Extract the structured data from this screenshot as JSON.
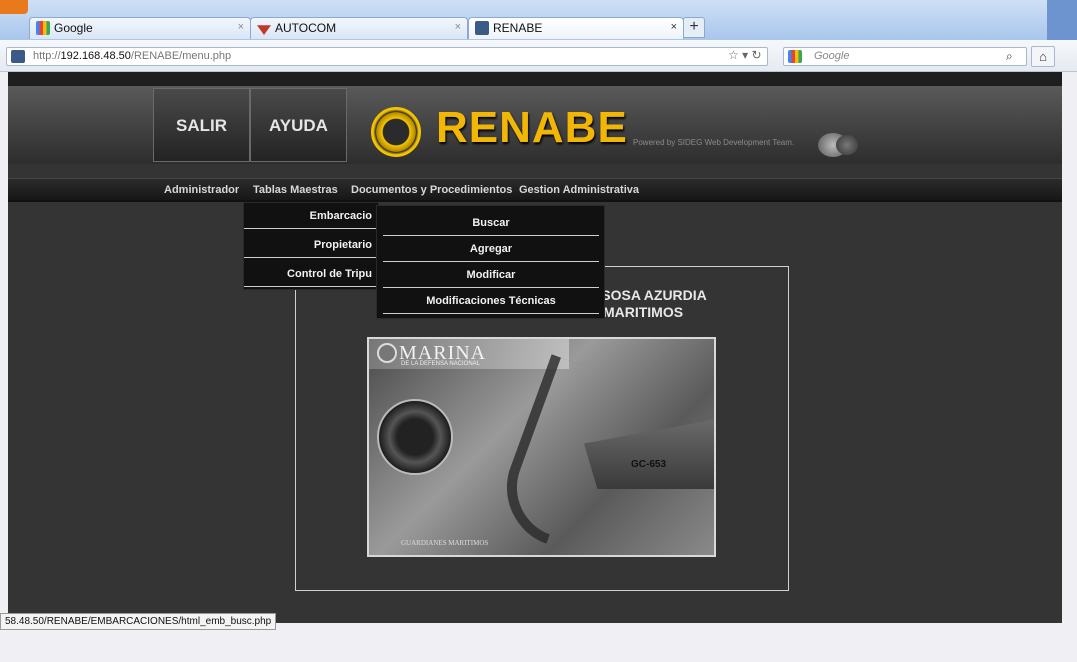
{
  "browser": {
    "tabs": [
      {
        "label": "Google",
        "favicon": "google-icon",
        "active": false
      },
      {
        "label": "AUTOCOM",
        "favicon": "autocom-icon",
        "active": false
      },
      {
        "label": "RENABE",
        "favicon": "renabe-icon",
        "active": true
      }
    ],
    "new_tab": "+",
    "url_prefix": "http://",
    "url_host": "192.168.48.50",
    "url_path": "/RENABE/menu.php",
    "search_placeholder": "Google",
    "status_url": "58.48.50/RENABE/EMBARCACIONES/html_emb_busc.php"
  },
  "header": {
    "buttons": [
      {
        "label": "SALIR"
      },
      {
        "label": "AYUDA"
      }
    ],
    "logo_text": "RENABE",
    "powered_by": "Powered by SIDEG Web Development Team."
  },
  "menu": {
    "items": [
      {
        "label": "Administrador"
      },
      {
        "label": "Tablas Maestras"
      },
      {
        "label": "Documentos y Procedimientos"
      },
      {
        "label": "Gestion Administrativa"
      }
    ]
  },
  "dropdown1": {
    "items": [
      {
        "label": "Embarcacio"
      },
      {
        "label": "Propietario"
      },
      {
        "label": "Control de Tripu"
      }
    ]
  },
  "dropdown2": {
    "items": [
      {
        "label": "Buscar"
      },
      {
        "label": "Agregar"
      },
      {
        "label": "Modificar"
      },
      {
        "label": "Modificaciones Técnicas"
      }
    ]
  },
  "welcome": {
    "line1": "Bienve                                    ISCO SOSA AZURDIA",
    "line2": "D                                         TOS MARITIMOS"
  },
  "photo": {
    "brand": "MARINA",
    "brand_sub": "DE LA DEFENSA NACIONAL",
    "ship_number": "GC-653",
    "caption": "GUARDIANES MARITIMOS"
  },
  "colors": {
    "logo": "#f2b705",
    "page_bg": "#343434"
  }
}
